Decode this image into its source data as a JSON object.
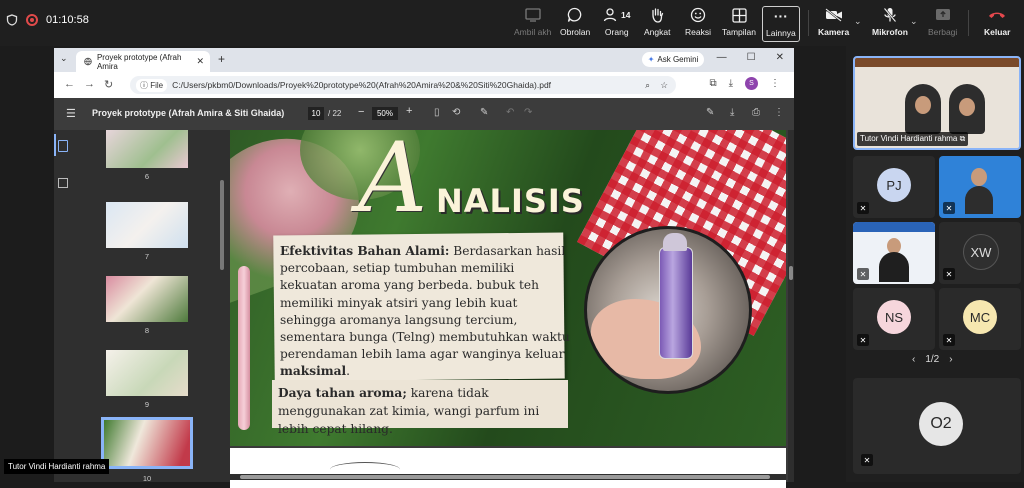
{
  "meeting": {
    "timer": "01:10:58",
    "toolbar": [
      {
        "label": "Ambil akh",
        "icon": "screenshot-icon",
        "enabled": false
      },
      {
        "label": "Obrolan",
        "icon": "chat-icon",
        "enabled": true
      },
      {
        "label": "Orang",
        "icon": "people-icon",
        "count": "14",
        "enabled": true
      },
      {
        "label": "Angkat",
        "icon": "hand-icon",
        "enabled": true
      },
      {
        "label": "Reaksi",
        "icon": "smile-icon",
        "enabled": true
      },
      {
        "label": "Tampilan",
        "icon": "grid-icon",
        "enabled": true
      },
      {
        "label": "Lainnya",
        "icon": "more-icon",
        "enabled": true
      },
      {
        "label": "Kamera",
        "icon": "camera-off-icon",
        "enabled": true
      },
      {
        "label": "Mikrofon",
        "icon": "mic-off-icon",
        "enabled": true
      },
      {
        "label": "Berbagi",
        "icon": "share-icon",
        "enabled": false
      },
      {
        "label": "Keluar",
        "icon": "hangup-icon",
        "enabled": true
      }
    ],
    "presenter_caption": "Tutor Vindi Hardianti rahma",
    "participants": [
      {
        "name": "Tutor Vindi Hardianti rahma",
        "type": "video"
      },
      {
        "initials": "PJ",
        "color": "#c9d6f0"
      },
      {
        "type": "video"
      },
      {
        "type": "video"
      },
      {
        "initials": "XW",
        "color": "#2f2f2f"
      },
      {
        "initials": "NS",
        "color": "#f6d6dc"
      },
      {
        "initials": "MC",
        "color": "#f6e7b0"
      },
      {
        "initials": "O2",
        "color": "#e6e6e6"
      }
    ],
    "pager": "1/2"
  },
  "browser": {
    "tab_title": "Proyek prototype (Afrah Amira",
    "gemini_label": "Ask Gemini",
    "file_label": "File",
    "url": "C:/Users/pkbm0/Downloads/Proyek%20prototype%20(Afrah%20Amira%20&%20Siti%20Ghaida).pdf",
    "profile_initial": "S"
  },
  "pdf": {
    "title": "Proyek prototype (Afrah Amira & Siti Ghaida)",
    "page_current": "10",
    "page_total": "/ 22",
    "zoom": "50%",
    "thumbnails": [
      "6",
      "7",
      "8",
      "9",
      "10"
    ],
    "selected_thumbnail": "10"
  },
  "slide": {
    "heading_initial": "A",
    "heading_rest": "NALISIS",
    "para1_lead": "Efektivitas Bahan Alami:",
    "para1_body": " Berdasarkan hasil percobaan, setiap tumbuhan memiliki kekuatan aroma yang berbeda. bubuk teh memiliki minyak atsiri yang lebih kuat sehingga aromanya langsung tercium, sementara bunga (Telng) membutuhkan waktu perendaman lebih lama agar wanginya keluar ",
    "para1_end": "maksimal",
    "para1_dot": ".",
    "para2_lead": "Daya tahan aroma;",
    "para2_body": " karena tidak menggunakan zat kimia, wangi parfum ini lebih cepat hilang."
  }
}
